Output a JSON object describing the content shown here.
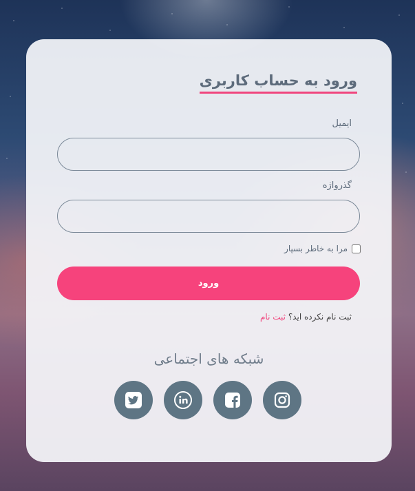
{
  "form": {
    "title": "ورود به حساب کاربری",
    "email_label": "ایمیل",
    "email_value": "",
    "password_label": "گذرواژه",
    "password_value": "",
    "remember_label": "مرا به خاطر بسپار",
    "remember_checked": false,
    "submit_label": "ورود",
    "signup_prompt": "ثبت نام نکرده اید؟",
    "signup_link": "ثبت نام"
  },
  "social": {
    "title": "شبکه های اجتماعی",
    "icons": [
      "twitter-icon",
      "linkedin-icon",
      "facebook-icon",
      "instagram-icon"
    ],
    "icon_color": "#5e7584"
  },
  "colors": {
    "accent": "#f6437c",
    "text": "#5d6b7b"
  }
}
